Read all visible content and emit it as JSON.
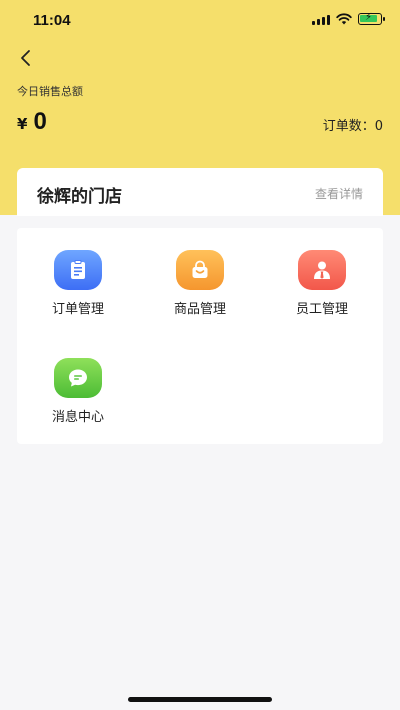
{
  "status_bar": {
    "time": "11:04"
  },
  "header": {
    "sales_label": "今日销售总额",
    "currency": "¥",
    "sales_value": "0",
    "orders_label": "订单数：",
    "orders_value": "0"
  },
  "store": {
    "name": "徐辉的门店",
    "detail_link": "查看详情"
  },
  "menu": {
    "items": [
      {
        "label": "订单管理",
        "icon": "clipboard-icon"
      },
      {
        "label": "商品管理",
        "icon": "shopping-bag-icon"
      },
      {
        "label": "员工管理",
        "icon": "employee-icon"
      },
      {
        "label": "消息中心",
        "icon": "message-icon"
      }
    ]
  },
  "colors": {
    "header_bg": "#f5df6b",
    "order_icon": "#4a7cf6",
    "goods_icon": "#f5a23b",
    "staff_icon": "#f36453",
    "message_icon": "#5cc640"
  }
}
